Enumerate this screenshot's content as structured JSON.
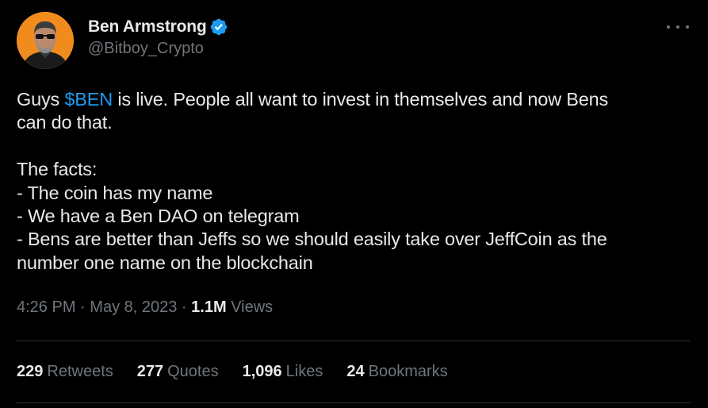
{
  "author": {
    "display_name": "Ben Armstrong",
    "handle": "@Bitboy_Crypto",
    "verified": true,
    "avatar_icon": "profile-photo"
  },
  "more_icon": "more-horizontal-icon",
  "tweet": {
    "line1_pre": "Guys ",
    "cashtag": "$BEN",
    "line1_post": " is live. People all want to invest in themselves and now Bens",
    "line2": "can do that.",
    "line3": "The facts:",
    "line4": "- The coin has my name",
    "line5": "- We have a Ben DAO on telegram",
    "line6": "- Bens are better than Jeffs so we should easily take over JeffCoin as the",
    "line7": "number one name on the blockchain"
  },
  "meta": {
    "time": "4:26 PM",
    "separator": "·",
    "date": "May 8, 2023",
    "views_count": "1.1M",
    "views_label": "Views"
  },
  "stats": {
    "retweets_count": "229",
    "retweets_label": "Retweets",
    "quotes_count": "277",
    "quotes_label": "Quotes",
    "likes_count": "1,096",
    "likes_label": "Likes",
    "bookmarks_count": "24",
    "bookmarks_label": "Bookmarks"
  },
  "colors": {
    "background": "#000000",
    "text": "#e7e9ea",
    "muted": "#71767b",
    "link": "#1d9bf0",
    "verified": "#1d9bf0",
    "divider": "#2f3336",
    "avatar_bg": "#f08c1e"
  }
}
